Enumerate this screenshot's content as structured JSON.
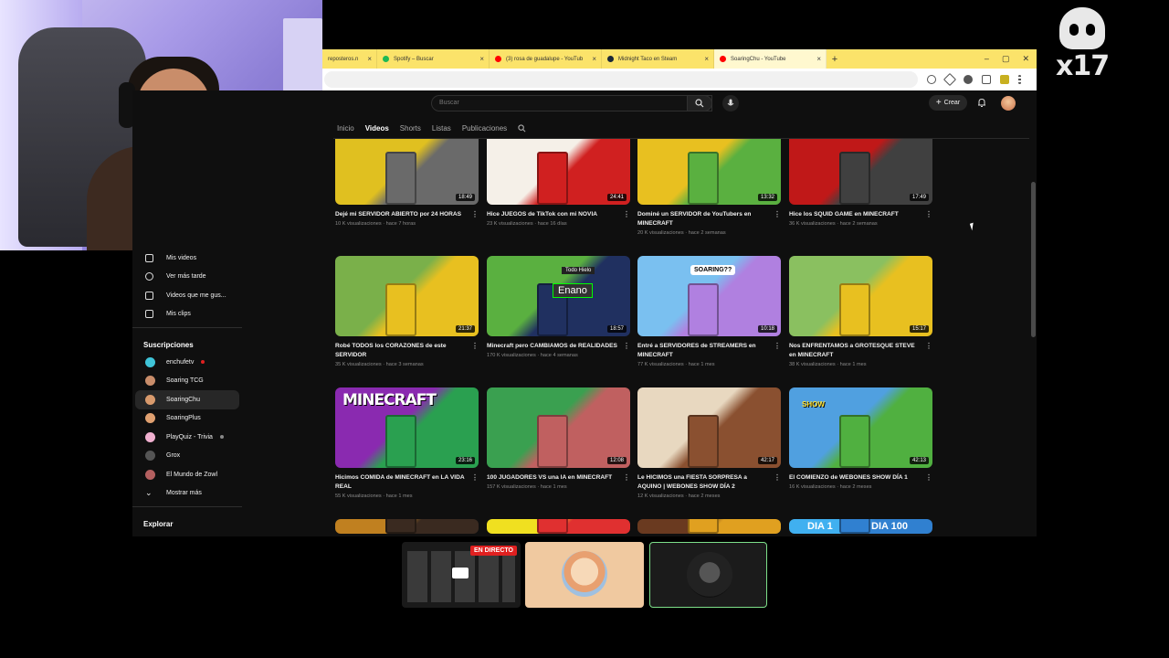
{
  "browser": {
    "tabs": [
      {
        "label": "reposteros.n",
        "color": "#ff8a00"
      },
      {
        "label": "Spotify – Buscar",
        "color": "#1db954"
      },
      {
        "label": "(3) rosa de guadalupe - YouTub",
        "color": "#ff0000"
      },
      {
        "label": "Midnight Taco en Steam",
        "color": "#1b2838"
      },
      {
        "label": "SoaringChu - YouTube",
        "color": "#ff0000"
      }
    ],
    "new_tab": "+",
    "window_controls": [
      "–",
      "▢",
      "✕"
    ]
  },
  "yt": {
    "search_placeholder": "Buscar",
    "create_label": "Crear",
    "channel_tabs": [
      "Inicio",
      "Videos",
      "Shorts",
      "Listas",
      "Publicaciones"
    ],
    "active_tab": "Videos"
  },
  "sidebar": {
    "items": [
      {
        "label": "Mis videos",
        "icon": "play-square-icon"
      },
      {
        "label": "Ver más tarde",
        "icon": "clock-icon"
      },
      {
        "label": "Videos que me gus...",
        "icon": "thumbs-up-icon"
      },
      {
        "label": "Mis clips",
        "icon": "scissors-icon"
      }
    ],
    "subs_header": "Suscripciones",
    "subs": [
      {
        "label": "enchufetv",
        "color": "#3fc4d8",
        "dot": "#e02020"
      },
      {
        "label": "Soaring TCG",
        "color": "#c98d6a",
        "dot": ""
      },
      {
        "label": "SoaringChu",
        "color": "#d99a6c",
        "dot": "",
        "selected": true
      },
      {
        "label": "SoaringPlus",
        "color": "#e0a070",
        "dot": ""
      },
      {
        "label": "PlayQuiz - Trivia",
        "color": "#f0b0d0",
        "dot": "#888888"
      },
      {
        "label": "Grox",
        "color": "#555555",
        "dot": ""
      },
      {
        "label": "El Mundo de Zowl",
        "color": "#b46060",
        "dot": ""
      }
    ],
    "more": "Mostrar más",
    "explore_header": "Explorar"
  },
  "videos": [
    {
      "title": "Dejé mi SERVIDOR ABIERTO por 24 HORAS",
      "meta": "10 K visualizaciones · hace 7 horas",
      "duration": "18:49",
      "c1": "#e0c020",
      "c2": "#6a6a6a"
    },
    {
      "title": "Hice JUEGOS de TikTok con mi NOVIA",
      "meta": "23 K visualizaciones · hace 16 días",
      "duration": "24:41",
      "c1": "#f5f0e8",
      "c2": "#d02020"
    },
    {
      "title": "Dominé un SERVIDOR de YouTubers en MINECRAFT",
      "meta": "20 K visualizaciones · hace 2 semanas",
      "duration": "13:32",
      "c1": "#e8c020",
      "c2": "#5ab040"
    },
    {
      "title": "Hice los SQUID GAME en MINECRAFT",
      "meta": "36 K visualizaciones · hace 2 semanas",
      "duration": "17:49",
      "c1": "#c01818",
      "c2": "#404040"
    },
    {
      "title": "Robé TODOS los CORAZONES de este SERVIDOR",
      "meta": "35 K visualizaciones · hace 3 semanas",
      "duration": "21:37",
      "c1": "#7ab04a",
      "c2": "#e8c020"
    },
    {
      "title": "Minecraft pero CAMBIAMOS de REALIDADES",
      "meta": "170 K visualizaciones · hace 4 semanas",
      "duration": "18:57",
      "c1": "#5ab040",
      "c2": "#203060"
    },
    {
      "title": "Entré a SERVIDORES de STREAMERS en MINECRAFT",
      "meta": "77 K visualizaciones · hace 1 mes",
      "duration": "10:18",
      "c1": "#7ac0f0",
      "c2": "#b080e0"
    },
    {
      "title": "Nos ENFRENTAMOS a GROTESQUE STEVE en MINECRAFT",
      "meta": "38 K visualizaciones · hace 1 mes",
      "duration": "15:17",
      "c1": "#8ac060",
      "c2": "#e8c020"
    },
    {
      "title": "Hicimos COMIDA de MINECRAFT en LA VIDA REAL",
      "meta": "55 K visualizaciones · hace 1 mes",
      "duration": "23:16",
      "c1": "#8a2ab0",
      "c2": "#2aa050"
    },
    {
      "title": "100 JUGADORES VS una IA en MINECRAFT",
      "meta": "157 K visualizaciones · hace 1 mes",
      "duration": "12:08",
      "c1": "#3aa050",
      "c2": "#c06060"
    },
    {
      "title": "Le HICIMOS una FIESTA SORPRESA a AQUINO | WEBONES SHOW DÍA 2",
      "meta": "12 K visualizaciones · hace 2 meses",
      "duration": "42:17",
      "c1": "#e8d8c0",
      "c2": "#8a5030"
    },
    {
      "title": "El COMIENZO de WEBONES SHOW DÍA 1",
      "meta": "16 K visualizaciones · hace 2 meses",
      "duration": "42:13",
      "c1": "#50a0e0",
      "c2": "#50b040"
    },
    {
      "title": "",
      "meta": "",
      "duration": "",
      "c1": "#c08020",
      "c2": "#3a2a20"
    },
    {
      "title": "",
      "meta": "",
      "duration": "",
      "c1": "#f0e020",
      "c2": "#e03030"
    },
    {
      "title": "",
      "meta": "",
      "duration": "",
      "c1": "#6a3a20",
      "c2": "#e0a020"
    },
    {
      "title": "",
      "meta": "",
      "duration": "",
      "c1": "#40b0f0",
      "c2": "#3080d0"
    }
  ],
  "partial_thumb_text": {
    "dia1": "DIA 1",
    "dia100": "DIA 100"
  },
  "thumb_texts": {
    "minecraft": "MINECRAFT",
    "enano": "Enano",
    "soaring": "SOARING??",
    "todo": "Todo Hielo",
    "show": "SHOW"
  },
  "overlay": {
    "logo_text": "x17",
    "live_badge": "EN DIRECTO"
  }
}
